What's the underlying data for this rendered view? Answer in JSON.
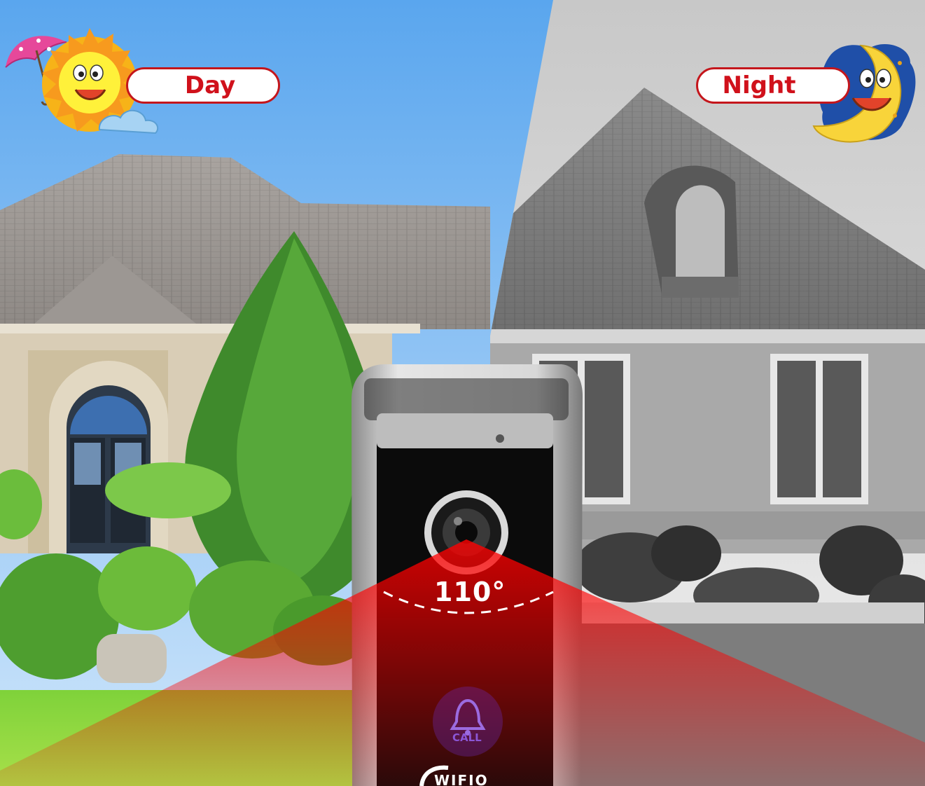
{
  "labels": {
    "day": "Day",
    "night": "Night"
  },
  "doorbell": {
    "view_angle": "110°",
    "call_button": "CALL",
    "brand_partial": "WIFIO"
  },
  "colors": {
    "label_red": "#d0111b",
    "beam_red": "#ff0000",
    "call_purple": "#8b56d6",
    "sky_blue": "#6fb4ef"
  },
  "icons": {
    "day": [
      "sun-icon",
      "umbrella-icon",
      "cloud-icon"
    ],
    "night": [
      "moon-icon",
      "night-cloud-icon"
    ]
  }
}
